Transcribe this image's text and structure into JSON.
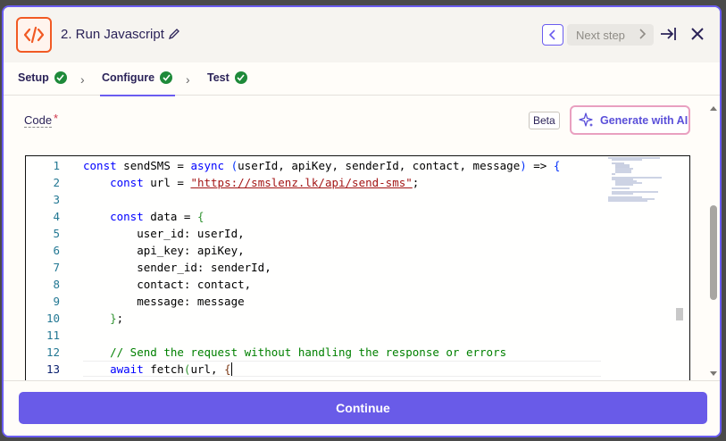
{
  "header": {
    "title": "2. Run Javascript",
    "next_step_label": "Next step"
  },
  "tabs": [
    {
      "label": "Setup"
    },
    {
      "label": "Configure"
    },
    {
      "label": "Test"
    }
  ],
  "field": {
    "label": "Code",
    "required_mark": "*",
    "beta_label": "Beta",
    "ai_button_label": "Generate with AI"
  },
  "editor": {
    "line_numbers": [
      "1",
      "2",
      "3",
      "4",
      "5",
      "6",
      "7",
      "8",
      "9",
      "10",
      "11",
      "12",
      "13"
    ],
    "current_line": 13
  },
  "footer": {
    "continue_label": "Continue"
  },
  "colors": {
    "accent": "#695be8",
    "app_icon": "#f15a24",
    "success": "#1e8a3a"
  }
}
